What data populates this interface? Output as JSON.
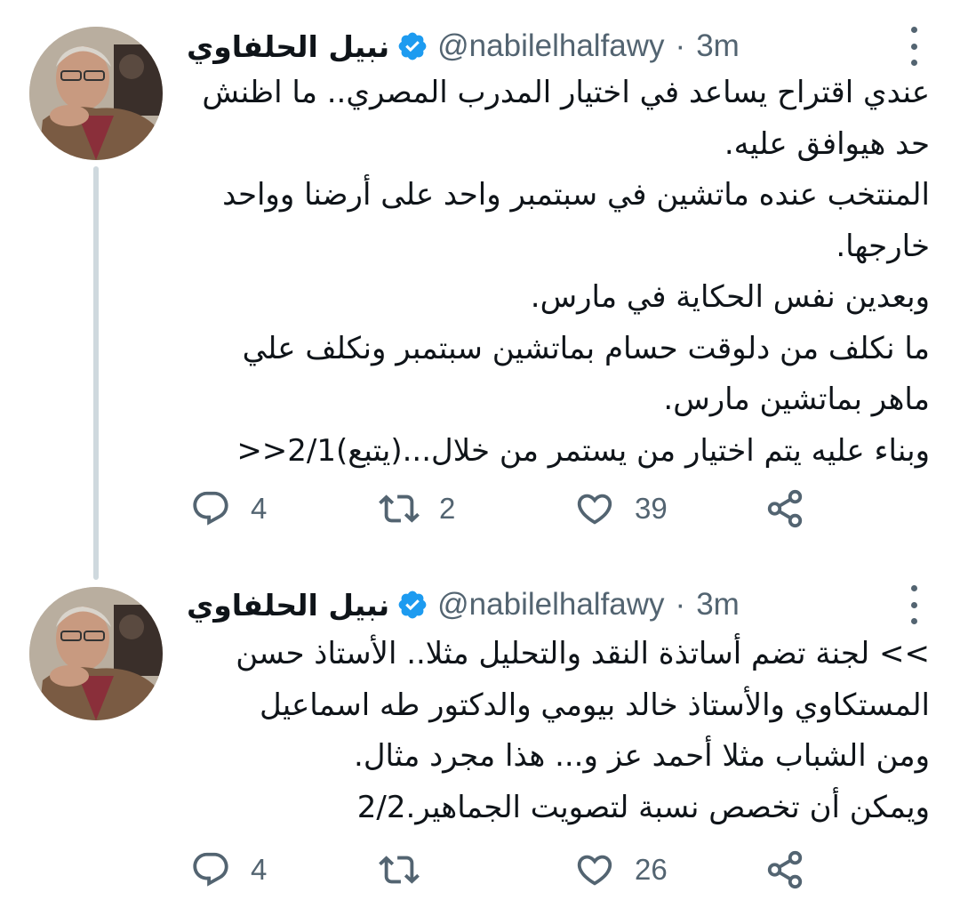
{
  "colors": {
    "text": "#0f1419",
    "secondary": "#536471",
    "verified": "#1d9bf0",
    "thread_line": "#cfd9de"
  },
  "tweets": [
    {
      "author_name": "نبيل الحلفاوي",
      "handle": "@nabilelhalfawy",
      "separator": "·",
      "time": "3m",
      "verified_icon": "verified-badge-icon",
      "lines": [
        "عندي اقتراح يساعد في اختيار المدرب المصري.. ما اظنش",
        "حد هيوافق عليه.",
        "المنتخب عنده ماتشين في سبتمبر واحد على أرضنا وواحد",
        "خارجها.",
        "وبعدين نفس الحكاية في مارس.",
        "ما نكلف من دلوقت حسام بماتشين سبتمبر ونكلف علي",
        "ماهر بماتشين مارس.",
        "وبناء عليه يتم اختيار من يستمر من خلال...(يتبع)2/1<<"
      ],
      "replies": "4",
      "retweets": "2",
      "likes": "39"
    },
    {
      "author_name": "نبيل الحلفاوي",
      "handle": "@nabilelhalfawy",
      "separator": "·",
      "time": "3m",
      "verified_icon": "verified-badge-icon",
      "lines": [
        ">> لجنة تضم أساتذة النقد والتحليل مثلا.. الأستاذ حسن",
        "المستكاوي والأستاذ خالد بيومي والدكتور طه اسماعيل",
        "ومن الشباب مثلا أحمد عز و... هذا مجرد مثال.",
        "ويمكن أن تخصص نسبة لتصويت الجماهير.2/2"
      ],
      "replies": "4",
      "retweets": "",
      "likes": "26"
    }
  ]
}
